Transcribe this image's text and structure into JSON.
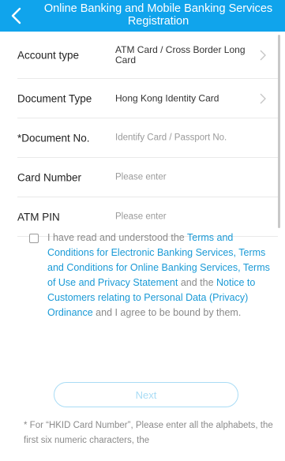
{
  "header": {
    "title": "Online Banking and Mobile Banking Services Registration",
    "back_icon": "chevron-left-icon",
    "color": "#10a4ec"
  },
  "form": {
    "account_type": {
      "label": "Account type",
      "value": "ATM Card / Cross Border Long Card"
    },
    "document_type": {
      "label": "Document Type",
      "value": "Hong Kong Identity Card"
    },
    "document_no": {
      "label": "*Document No.",
      "placeholder": "Identify Card / Passport No."
    },
    "card_number": {
      "label": "Card Number",
      "placeholder": "Please enter"
    },
    "atm_pin": {
      "label": "ATM PIN",
      "placeholder": "Please enter"
    }
  },
  "agreement": {
    "part1": "I have read and understood the ",
    "link1": "Terms and Conditions for Electronic Banking Services, Terms and Conditions for Online Banking Services, Terms of Use and Privacy Statement",
    "part2": " and the ",
    "link2": "Notice to Customers relating to Personal Data (Privacy) Ordinance",
    "part3": " and I agree to be bound by them.",
    "link_color": "#1a9ad6"
  },
  "next_button": {
    "label": "Next"
  },
  "footnote": "* For “HKID Card Number”, Please enter all the alphabets, the first six numeric characters, the"
}
